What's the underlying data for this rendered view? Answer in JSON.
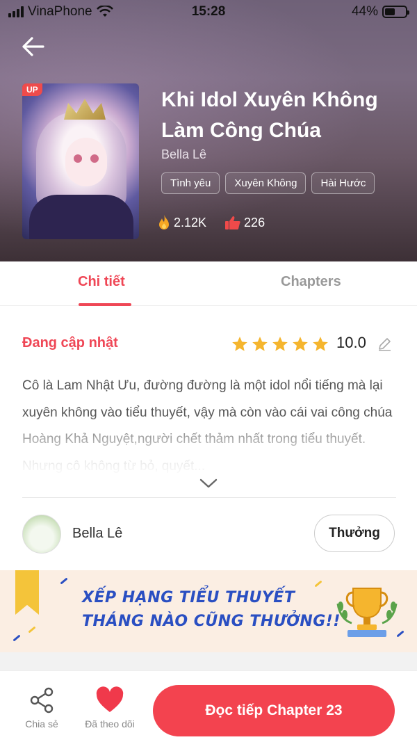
{
  "status_bar": {
    "carrier": "VinaPhone",
    "time": "15:28",
    "battery": "44%"
  },
  "header": {
    "back_icon": "arrow-left-icon",
    "badge": "UP",
    "title": "Khi Idol Xuyên Không Làm Công Chúa",
    "author": "Bella Lê",
    "tags": [
      "Tình yêu",
      "Xuyên Không",
      "Hài Hước"
    ],
    "views": "2.12K",
    "likes": "226"
  },
  "tabs": [
    {
      "label": "Chi tiết",
      "active": true
    },
    {
      "label": "Chapters",
      "active": false
    }
  ],
  "detail": {
    "status": "Đang cập nhật",
    "stars_filled": 5,
    "rating": "10.0",
    "description": "Cô là Lam Nhật Ưu, đường đường là một idol nổi tiếng mà lại xuyên không vào tiểu thuyết, vậy mà còn vào cái vai công chúa Hoàng Khả Nguyệt,người chết thảm nhất trong tiểu thuyết. Nhưng cô không từ bỏ, quyết..."
  },
  "author_row": {
    "name": "Bella Lê",
    "reward_label": "Thưởng"
  },
  "banner": {
    "line1": "XẾP HẠNG TIỂU THUYẾT",
    "line2": "THÁNG NÀO CŨNG THƯỞNG!!"
  },
  "bottom_bar": {
    "share_label": "Chia sẻ",
    "follow_label": "Đã theo dõi",
    "read_label": "Đọc tiếp Chapter 23"
  },
  "colors": {
    "accent": "#ef4756",
    "button": "#f3434f",
    "banner_text": "#2a4fc2",
    "star": "#f5b52e"
  }
}
